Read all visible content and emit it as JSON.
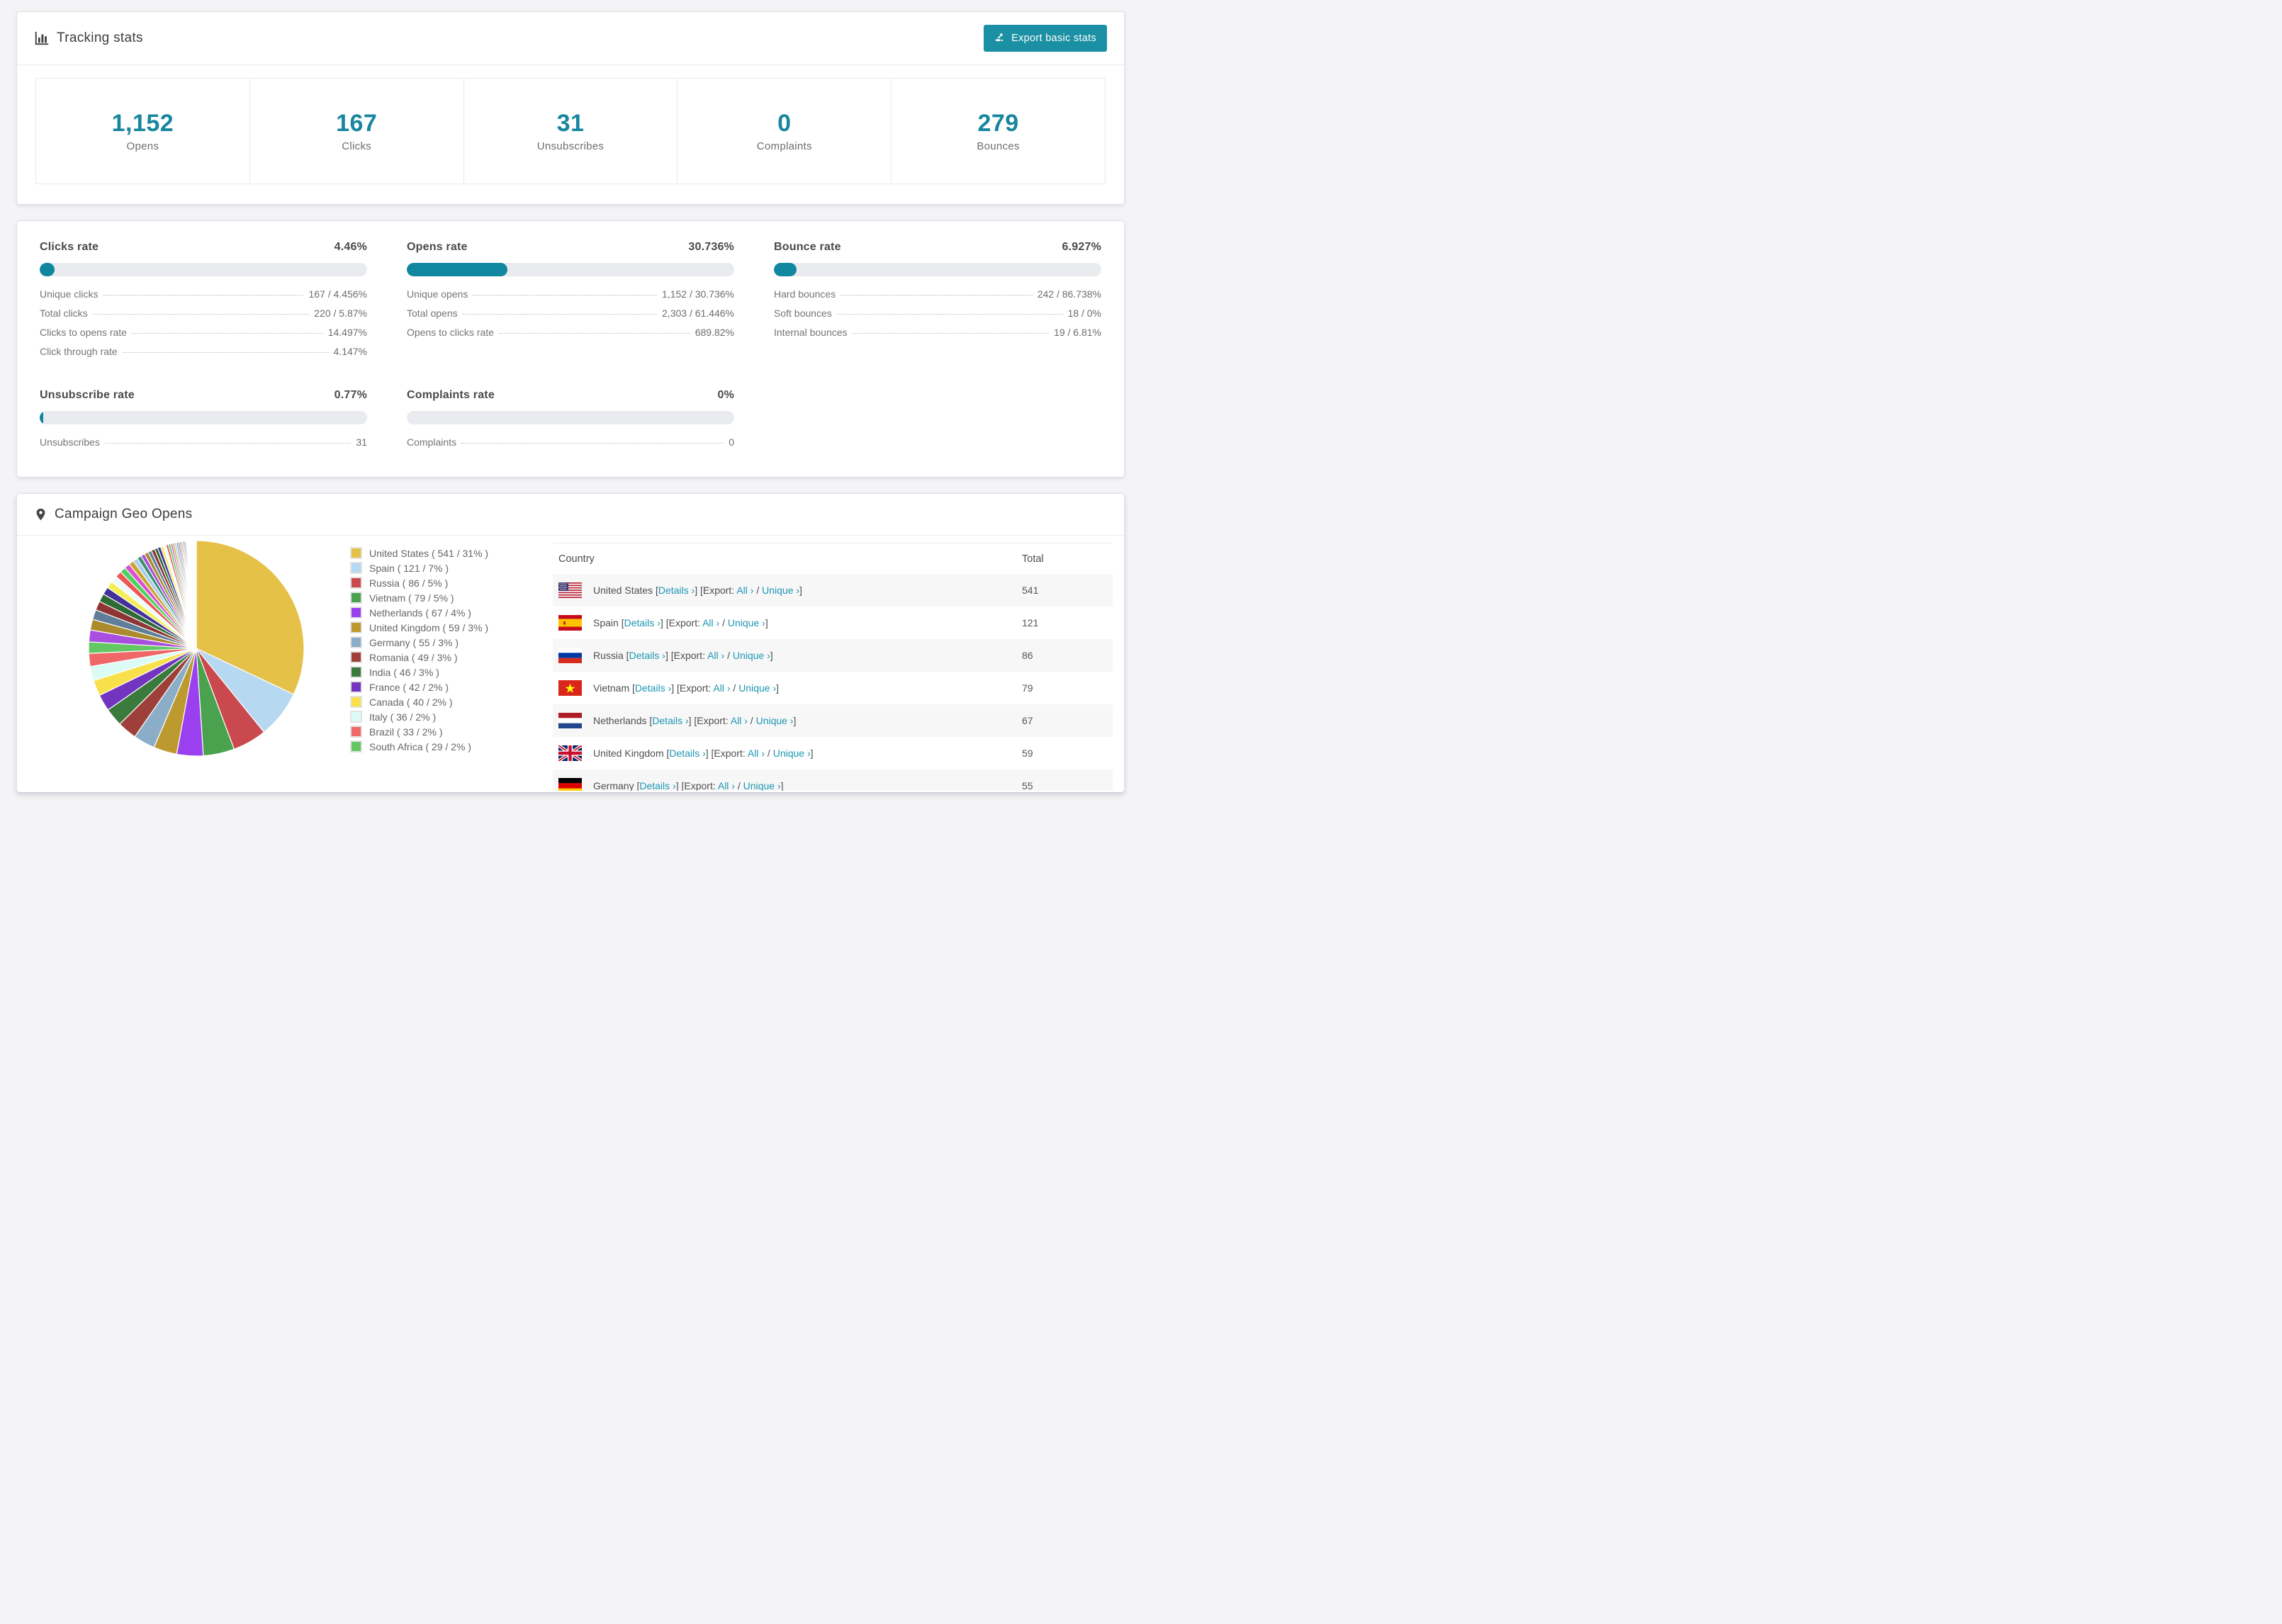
{
  "accent": "#17869e",
  "tracking": {
    "title": "Tracking stats",
    "export_label": "Export basic stats",
    "stats": [
      {
        "value": "1,152",
        "label": "Opens"
      },
      {
        "value": "167",
        "label": "Clicks"
      },
      {
        "value": "31",
        "label": "Unsubscribes"
      },
      {
        "value": "0",
        "label": "Complaints"
      },
      {
        "value": "279",
        "label": "Bounces"
      }
    ]
  },
  "rates": [
    {
      "title": "Clicks rate",
      "value": "4.46%",
      "percent": 4.46,
      "rows": [
        {
          "label": "Unique clicks",
          "value": "167 / 4.456%"
        },
        {
          "label": "Total clicks",
          "value": "220 / 5.87%"
        },
        {
          "label": "Clicks to opens rate",
          "value": "14.497%"
        },
        {
          "label": "Click through rate",
          "value": "4.147%"
        }
      ]
    },
    {
      "title": "Opens rate",
      "value": "30.736%",
      "percent": 30.736,
      "rows": [
        {
          "label": "Unique opens",
          "value": "1,152 / 30.736%"
        },
        {
          "label": "Total opens",
          "value": "2,303 / 61.446%"
        },
        {
          "label": "Opens to clicks rate",
          "value": "689.82%"
        }
      ]
    },
    {
      "title": "Bounce rate",
      "value": "6.927%",
      "percent": 6.927,
      "rows": [
        {
          "label": "Hard bounces",
          "value": "242 / 86.738%"
        },
        {
          "label": "Soft bounces",
          "value": "18 / 0%"
        },
        {
          "label": "Internal bounces",
          "value": "19 / 6.81%"
        }
      ]
    },
    {
      "title": "Unsubscribe rate",
      "value": "0.77%",
      "percent": 0.77,
      "rows": [
        {
          "label": "Unsubscribes",
          "value": "31"
        }
      ]
    },
    {
      "title": "Complaints rate",
      "value": "0%",
      "percent": 0,
      "rows": [
        {
          "label": "Complaints",
          "value": "0"
        }
      ]
    }
  ],
  "geo": {
    "title": "Campaign Geo Opens",
    "links": {
      "details": "Details ›",
      "export_prefix": "Export:",
      "all": "All ›",
      "unique": "Unique ›"
    },
    "table": {
      "country_header": "Country",
      "total_header": "Total",
      "rows": [
        {
          "country": "United States",
          "flag": "us",
          "total": "541"
        },
        {
          "country": "Spain",
          "flag": "es",
          "total": "121"
        },
        {
          "country": "Russia",
          "flag": "ru",
          "total": "86"
        },
        {
          "country": "Vietnam",
          "flag": "vn",
          "total": "79"
        },
        {
          "country": "Netherlands",
          "flag": "nl",
          "total": "67"
        },
        {
          "country": "United Kingdom",
          "flag": "gb",
          "total": "59"
        },
        {
          "country": "Germany",
          "flag": "de",
          "total": "55"
        }
      ]
    }
  },
  "chart_data": {
    "type": "pie",
    "title": "Campaign Geo Opens",
    "unit": "opens",
    "legend_position": "right",
    "slices": [
      {
        "label": "United States",
        "value": 541,
        "pct": "31%",
        "color": "#e5c148"
      },
      {
        "label": "Spain",
        "value": 121,
        "pct": "7%",
        "color": "#b7d8f1"
      },
      {
        "label": "Russia",
        "value": 86,
        "pct": "5%",
        "color": "#c9494e"
      },
      {
        "label": "Vietnam",
        "value": 79,
        "pct": "5%",
        "color": "#4aa24e"
      },
      {
        "label": "Netherlands",
        "value": 67,
        "pct": "4%",
        "color": "#9a40ee"
      },
      {
        "label": "United Kingdom",
        "value": 59,
        "pct": "3%",
        "color": "#bd9a2f"
      },
      {
        "label": "Germany",
        "value": 55,
        "pct": "3%",
        "color": "#8badc8"
      },
      {
        "label": "Romania",
        "value": 49,
        "pct": "3%",
        "color": "#9e3f3a"
      },
      {
        "label": "India",
        "value": 46,
        "pct": "3%",
        "color": "#3a7a3c"
      },
      {
        "label": "France",
        "value": 42,
        "pct": "2%",
        "color": "#7334c0"
      },
      {
        "label": "Canada",
        "value": 40,
        "pct": "2%",
        "color": "#f8e04b"
      },
      {
        "label": "Italy",
        "value": 36,
        "pct": "2%",
        "color": "#dbfcf5"
      },
      {
        "label": "Brazil",
        "value": 33,
        "pct": "2%",
        "color": "#f06767"
      },
      {
        "label": "South Africa",
        "value": 29,
        "pct": "2%",
        "color": "#63c764"
      }
    ],
    "others": {
      "note": "remaining small countries, unlabeled thin slices",
      "values": [
        30,
        27,
        25,
        23,
        21,
        19,
        18,
        17,
        16,
        15,
        14,
        13,
        12,
        11,
        10,
        10,
        9,
        9,
        8,
        8,
        7,
        7,
        6,
        6,
        5,
        5,
        5,
        4,
        4,
        4,
        3,
        3,
        3,
        3,
        2,
        2,
        2,
        2,
        2,
        2,
        1,
        1,
        1,
        1,
        1,
        1,
        1,
        1,
        1,
        1,
        1,
        1,
        1,
        1
      ],
      "colors": [
        "#a94fe0",
        "#ab8b2d",
        "#5f7f99",
        "#8e3434",
        "#2d6b33",
        "#43319b",
        "#f4ef55",
        "#eef9fb",
        "#ee5555",
        "#4fd162",
        "#dd4fd0",
        "#caa52f",
        "#a8cdeb",
        "#3e8f6f"
      ]
    }
  }
}
